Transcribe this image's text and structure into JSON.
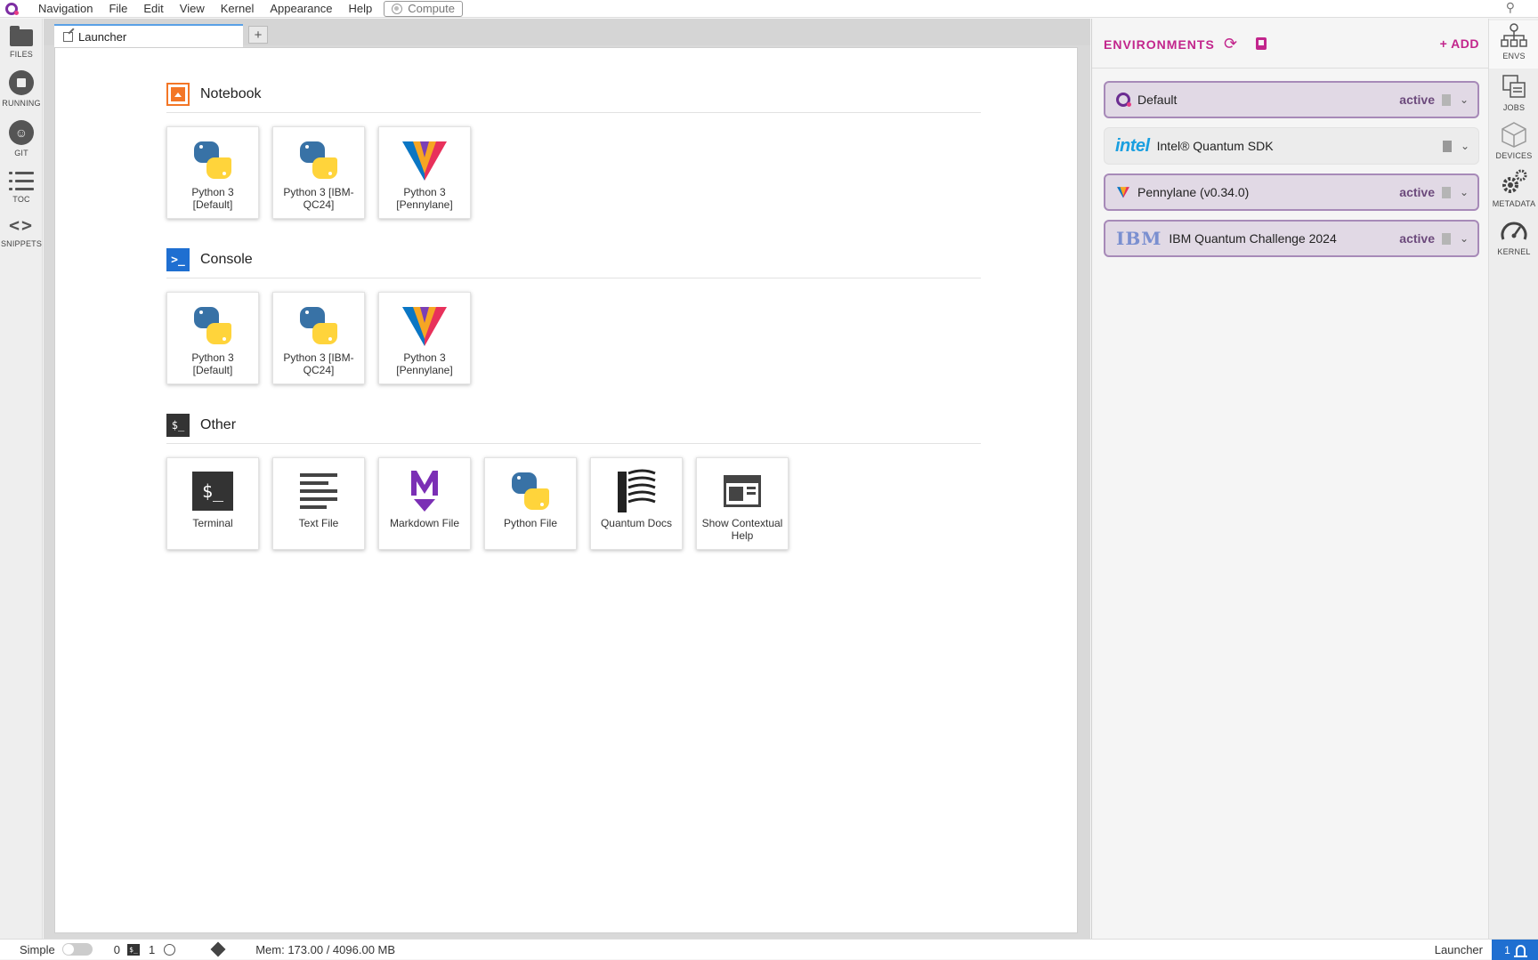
{
  "menubar": {
    "items": [
      "Navigation",
      "File",
      "Edit",
      "View",
      "Kernel",
      "Appearance",
      "Help"
    ],
    "compute_label": "Compute"
  },
  "left_sidebar": {
    "items": [
      {
        "label": "FILES",
        "icon": "folder-icon"
      },
      {
        "label": "RUNNING",
        "icon": "running-icon"
      },
      {
        "label": "GIT",
        "icon": "git-icon"
      },
      {
        "label": "TOC",
        "icon": "toc-icon"
      },
      {
        "label": "SNIPPETS",
        "icon": "snippets-icon"
      }
    ]
  },
  "tabs": {
    "active_label": "Launcher",
    "add_label": "+"
  },
  "launcher": {
    "sections": [
      {
        "title": "Notebook",
        "cards": [
          "Python 3 [Default]",
          "Python 3 [IBM-QC24]",
          "Python 3 [Pennylane]"
        ]
      },
      {
        "title": "Console",
        "cards": [
          "Python 3 [Default]",
          "Python 3 [IBM-QC24]",
          "Python 3 [Pennylane]"
        ]
      },
      {
        "title": "Other",
        "cards": [
          "Terminal",
          "Text File",
          "Markdown File",
          "Python File",
          "Quantum Docs",
          "Show Contextual Help"
        ]
      }
    ]
  },
  "environments": {
    "title": "ENVIRONMENTS",
    "add_label": "+ ADD",
    "items": [
      {
        "name": "Default",
        "status": "active"
      },
      {
        "name": "Intel® Quantum SDK",
        "status": ""
      },
      {
        "name": "Pennylane (v0.34.0)",
        "status": "active"
      },
      {
        "name": "IBM Quantum Challenge 2024",
        "status": "active"
      }
    ],
    "logos": {
      "intel": "intel",
      "ibm": "IBM"
    }
  },
  "right_sidebar": {
    "items": [
      "ENVS",
      "JOBS",
      "DEVICES",
      "METADATA",
      "KERNEL"
    ]
  },
  "statusbar": {
    "simple_label": "Simple",
    "count_a": "0",
    "term_glyph": "$_",
    "count_b": "1",
    "memory": "Mem: 173.00 / 4096.00 MB",
    "right_label": "Launcher",
    "notification_count": "1"
  },
  "colors": {
    "accent": "#c2258c",
    "tab_indicator": "#5aa0e6",
    "notification": "#1f6fd1",
    "notebook_icon": "#f37626",
    "console_icon": "#1f6fd1"
  }
}
